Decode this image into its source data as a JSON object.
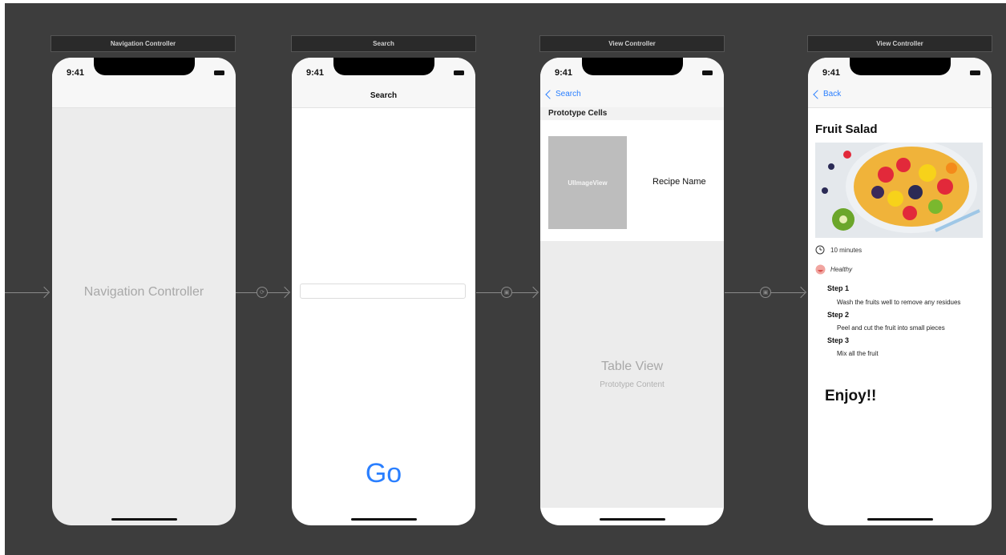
{
  "scenes": [
    {
      "label": "Navigation Controller"
    },
    {
      "label": "Search"
    },
    {
      "label": "View Controller"
    },
    {
      "label": "View Controller"
    }
  ],
  "status": {
    "time": "9:41"
  },
  "nav_controller": {
    "title": "Navigation Controller"
  },
  "search_screen": {
    "nav_title": "Search",
    "go_label": "Go"
  },
  "table_screen": {
    "back_label": "Search",
    "section_header": "Prototype Cells",
    "image_placeholder": "UIImageView",
    "cell_label": "Recipe Name",
    "table_title": "Table View",
    "table_subtitle": "Prototype Content"
  },
  "detail_screen": {
    "back_label": "Back",
    "title": "Fruit Salad",
    "duration": "10 minutes",
    "category": "Healthy",
    "steps": [
      {
        "title": "Step 1",
        "text": "Wash the fruits well to remove any residues"
      },
      {
        "title": "Step 2",
        "text": "Peel and cut the fruit into small pieces"
      },
      {
        "title": "Step 3",
        "text": "Mix all the fruit"
      }
    ],
    "closing": "Enjoy!!"
  },
  "colors": {
    "canvas": "#3d3d3d",
    "accent": "#2a7fff",
    "placeholder_gray": "#bdbdbd"
  }
}
